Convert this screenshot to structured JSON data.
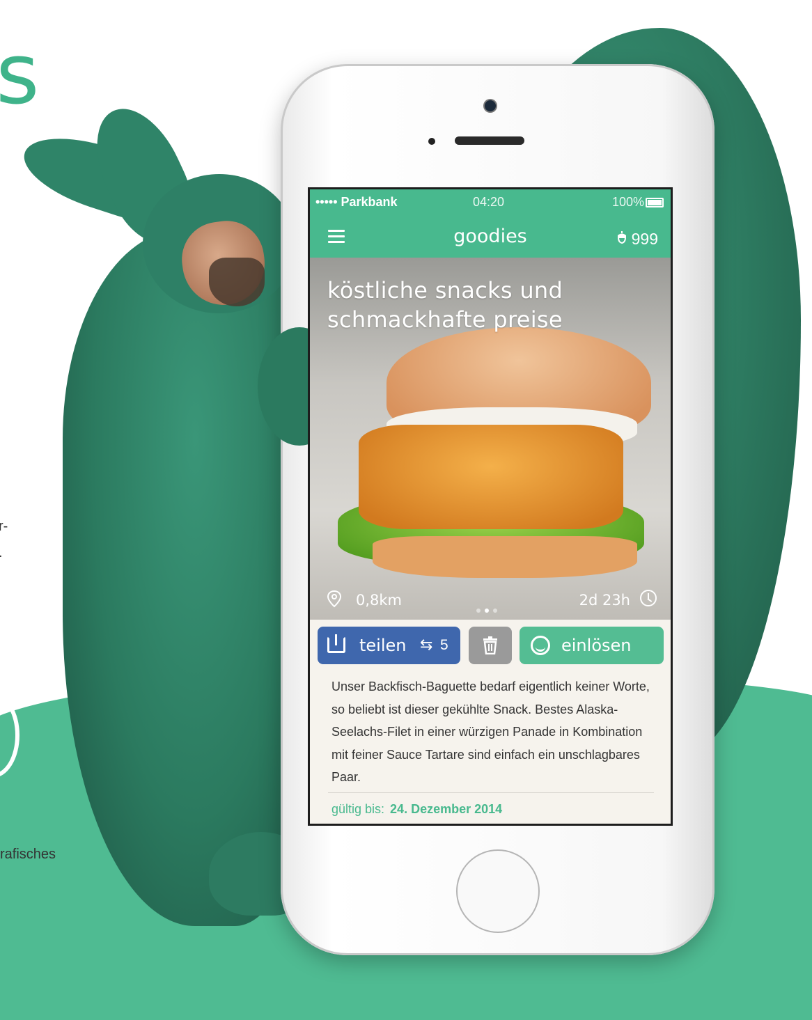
{
  "background": {
    "headline_fragment": "s",
    "side_text_1": "r-",
    "side_text_2": ".",
    "side_text_3": "rafisches",
    "ring_fragment": ")"
  },
  "status_bar": {
    "carrier": "••••• Parkbank",
    "time": "04:20",
    "battery": "100%"
  },
  "nav": {
    "title": "goodies",
    "nut_count": "999"
  },
  "hero": {
    "title_line1": "köstliche snacks und",
    "title_line2": "schmackhafte preise",
    "distance": "0,8km",
    "remaining": "2d 23h",
    "carousel_pages": 3,
    "carousel_active": 2
  },
  "actions": {
    "share_label": "teilen",
    "share_count": "5",
    "redeem_label": "einlösen"
  },
  "description": "Unser Backfisch-Baguette bedarf eigentlich keiner Worte, so beliebt ist dieser gekühlte Snack. Bestes Alaska-Seelachs-Filet in einer würzigen Panade in Kombination mit feiner Sauce Tartare sind einfach ein unschlagbares Paar.",
  "validity": {
    "label": "gültig bis:",
    "date": "24. Dezember 2014"
  },
  "colors": {
    "brand_green": "#48b98e",
    "share_blue": "#3f67ad",
    "trash_gray": "#9a9a9a"
  }
}
